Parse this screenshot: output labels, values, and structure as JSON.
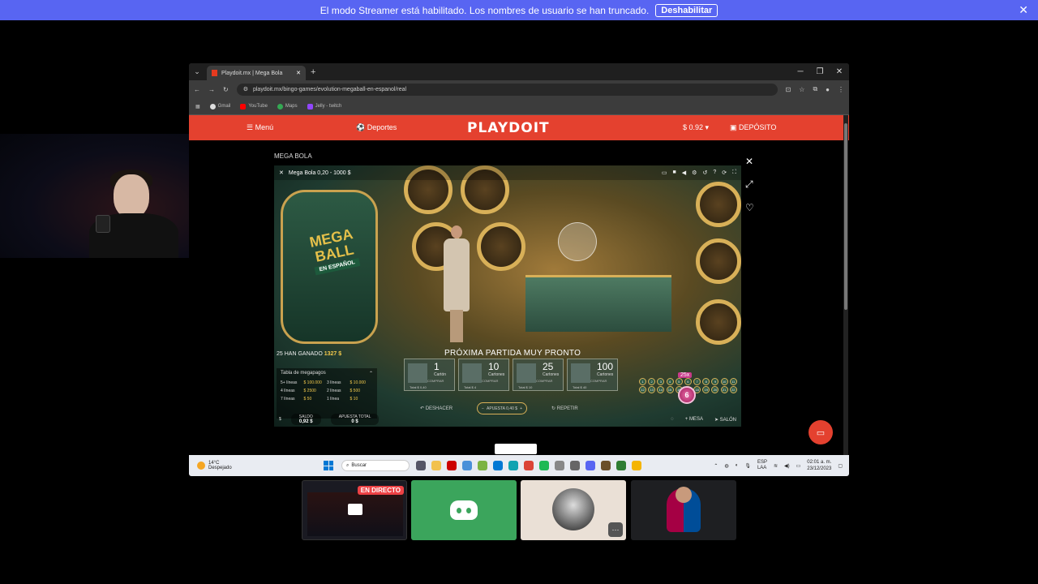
{
  "banner": {
    "text": "El modo Streamer está habilitado. Los nombres de usuario se han truncado.",
    "button": "Deshabilitar",
    "close": "✕"
  },
  "browser": {
    "tab_title": "Playdoit.mx | Mega Bola",
    "url": "playdoit.mx/bingo-games/evolution-megaball-en-espanol/real",
    "bookmarks": [
      "Gmail",
      "YouTube",
      "Maps",
      "Jelly - twitch"
    ],
    "win_controls": [
      "─",
      "❐",
      "✕"
    ]
  },
  "site": {
    "menu": "☰ Menú",
    "deportes": "Deportes",
    "logo": "PLAYDOIT",
    "balance": "$ 0.92 ▾",
    "deposito": "DEPÓSITO"
  },
  "game": {
    "page_title": "MEGA BOLA",
    "title": "Mega Bola 0,20 - 1000 $",
    "logo_line1": "MEGA",
    "logo_line2": "BALL",
    "logo_sub": "EN ESPAÑOL",
    "wins": "25 ",
    "wins_label": "HAN GANADO",
    "wins_amount": "1327 $",
    "next_game": "PRÓXIMA PARTIDA MUY PRONTO",
    "paytable": {
      "title": "Tabla de megapagos",
      "rows": [
        [
          "5+ líneas",
          "$ 100.000",
          "3 líneas",
          "$ 10.000"
        ],
        [
          "4 líneas",
          "$ 2500",
          "2 líneas",
          "$ 500"
        ],
        [
          "7 líneas",
          "$ 50",
          "1 línea",
          "$ 10"
        ]
      ]
    },
    "cards": [
      {
        "num": "1",
        "label": "Cartón",
        "btn": "COMPRAR",
        "total": "Total $ 0,40"
      },
      {
        "num": "10",
        "label": "Cartones",
        "btn": "COMPRAR",
        "total": "Total $ 4"
      },
      {
        "num": "25",
        "label": "Cartones",
        "btn": "COMPRAR",
        "total": "Total $ 10"
      },
      {
        "num": "100",
        "label": "Cartones",
        "btn": "COMPRAR",
        "total": "Total $ 40"
      }
    ],
    "undo": "DESHACER",
    "repeat": "REPETIR",
    "chip": "APUESTA 0,40 $",
    "multiplier": "25x",
    "megaball": "6",
    "saldo_label": "SALDO",
    "saldo_value": "0,92 $",
    "apuesta_label": "APUESTA TOTAL",
    "apuesta_value": "0 $",
    "mesa": "MESA",
    "salon": "SALÓN",
    "numbers": [
      "1",
      "2",
      "3",
      "4",
      "5",
      "6",
      "7",
      "8",
      "9",
      "10",
      "11",
      "12",
      "13",
      "14",
      "15",
      "16",
      "17",
      "18",
      "19",
      "20",
      "21",
      "22"
    ]
  },
  "taskbar": {
    "temp": "14°C",
    "weather": "Despejado",
    "search": "Buscar",
    "lang1": "ESP",
    "lang2": "LAA",
    "time": "02:01 a. m.",
    "date": "23/12/2023"
  },
  "stream": {
    "live": "EN DIRECTO",
    "more": "···"
  }
}
